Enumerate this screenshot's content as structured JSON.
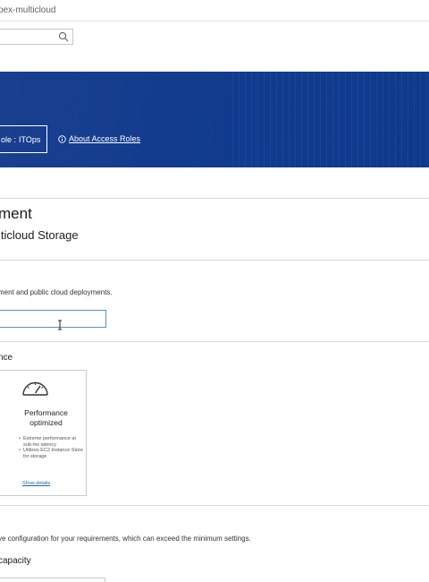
{
  "browser": {
    "url_fragment": "pex-multicloud"
  },
  "search": {
    "placeholder": ""
  },
  "banner": {
    "role_label": "ole :",
    "role_value": "ITOps",
    "about_link": "About Access Roles"
  },
  "page": {
    "title": "ment",
    "subtitle": "lticloud Storage"
  },
  "deployment": {
    "description": "ment and public cloud deployments.",
    "name_value": ""
  },
  "performance": {
    "section_label": "nce",
    "card": {
      "icon": "gauge-icon",
      "title_line1": "Performance",
      "title_line2": "optimized",
      "bullets": [
        "Extreme performance at sub-ms latency",
        "Utilizes EC2 Instance Store for storage"
      ],
      "link": "Show details"
    }
  },
  "configuration": {
    "text": "ve configuration for your requirements, which can exceed the minimum settings.",
    "capacity_label": "capacity"
  },
  "colors": {
    "banner": "#113b8e",
    "link": "#2164b5",
    "input_focus": "#5a90c8"
  }
}
